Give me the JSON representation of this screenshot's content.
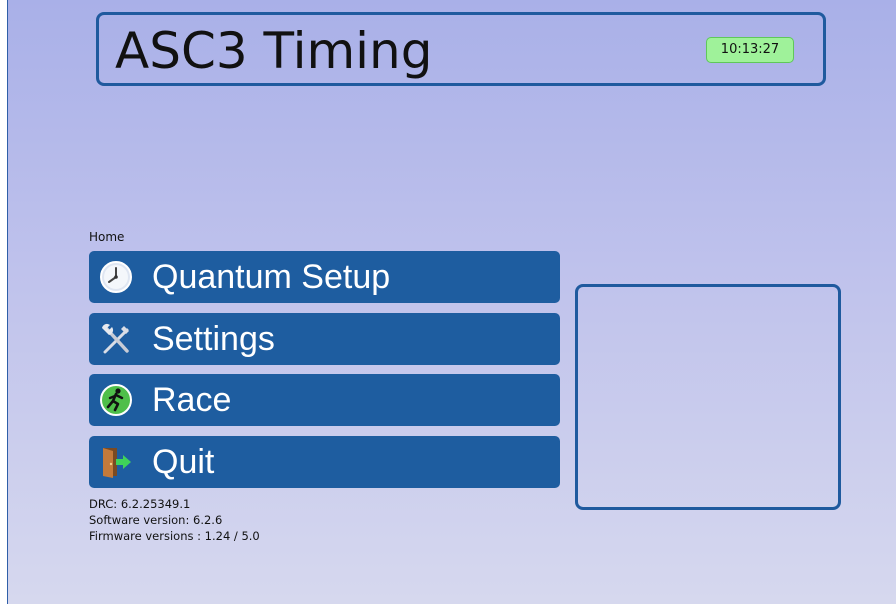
{
  "header": {
    "title": "ASC3 Timing",
    "clock": "10:13:27"
  },
  "breadcrumb": "Home",
  "menu": [
    {
      "label": "Quantum Setup",
      "icon": "clock-icon"
    },
    {
      "label": "Settings",
      "icon": "tools-icon"
    },
    {
      "label": "Race",
      "icon": "runner-icon"
    },
    {
      "label": "Quit",
      "icon": "exit-door-icon"
    }
  ],
  "info": {
    "drc": "DRC: 6.2.25349.1",
    "software": "Software version: 6.2.6",
    "firmware": "Firmware versions : 1.24 / 5.0"
  },
  "colors": {
    "button": "#1e5da0",
    "border": "#1f5a9e",
    "clock_bg": "#9ff29a"
  }
}
